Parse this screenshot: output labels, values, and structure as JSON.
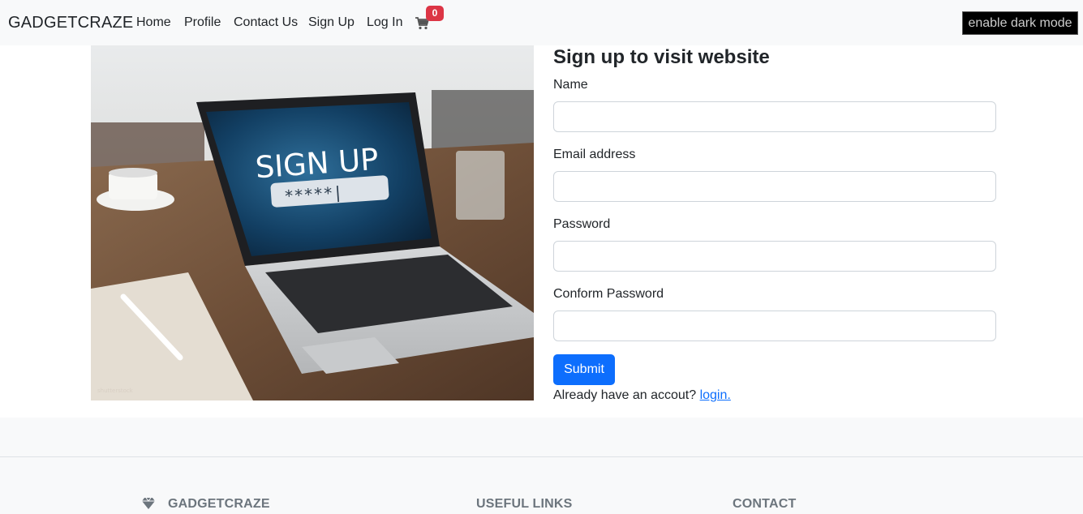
{
  "navbar": {
    "brand": "GADGETCRAZE",
    "links": [
      "Home",
      "Profile",
      "Contact Us",
      "Sign Up",
      "Log In"
    ],
    "cart_icon": "shopping-cart-icon",
    "cart_count": "0",
    "dark_mode_label": "enable dark mode"
  },
  "hero": {
    "screen_title": "SIGN UP",
    "password_mask": "*****|"
  },
  "form": {
    "title": "Sign up to visit website",
    "fields": [
      {
        "label": "Name",
        "value": ""
      },
      {
        "label": "Email address",
        "value": ""
      },
      {
        "label": "Password",
        "value": ""
      },
      {
        "label": "Conform Password",
        "value": ""
      }
    ],
    "submit_label": "Submit",
    "already_text": "Already have an accout?",
    "login_link": "login."
  },
  "footer": {
    "brand_icon": "gem-icon",
    "brand": "GADGETCRAZE",
    "useful_links": "USEFUL LINKS",
    "contact": "CONTACT"
  },
  "colors": {
    "primary": "#0d6efd",
    "badge": "#dc3545",
    "navbar_bg": "#f8f9fa",
    "footer_heading": "#6c757d"
  }
}
